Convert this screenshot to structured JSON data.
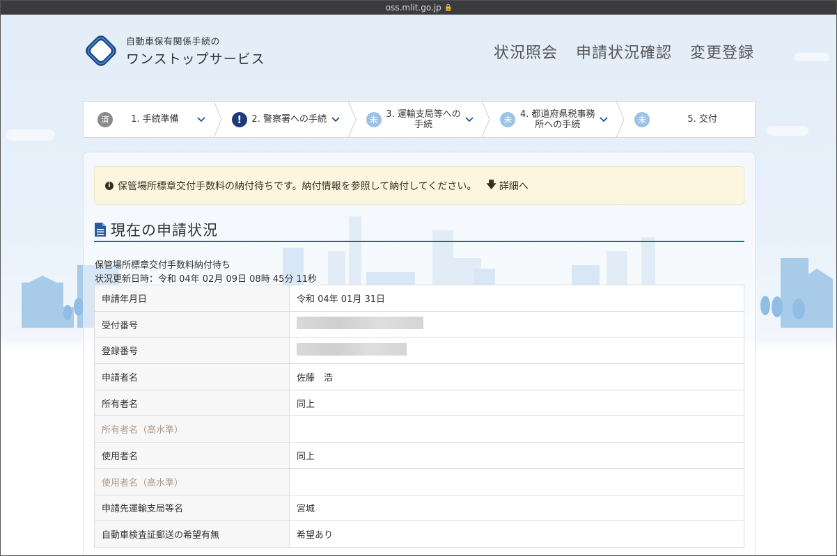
{
  "browser": {
    "url": "oss.mlit.go.jp"
  },
  "header": {
    "logo_small": "自動車保有関係手続の",
    "logo_big": "ワンストップサービス",
    "nav": [
      "状況照会",
      "申請状況確認",
      "変更登録"
    ]
  },
  "stepper": [
    {
      "badge": "済",
      "label": "1. 手続準備",
      "state": "done"
    },
    {
      "badge": "!",
      "label": "2. 警察署への手続",
      "state": "alert"
    },
    {
      "badge": "未",
      "label": "3. 運輸支局等への手続",
      "state": "todo"
    },
    {
      "badge": "未",
      "label": "4. 都道府県税事務所への手続",
      "state": "todo"
    },
    {
      "badge": "未",
      "label": "5. 交付",
      "state": "todo"
    }
  ],
  "alert": {
    "message": "保管場所標章交付手数料の納付待ちです。納付情報を参照して納付してください。",
    "link": "詳細へ"
  },
  "section": {
    "title": "現在の申請状況",
    "status": "保管場所標章交付手数料納付待ち",
    "updated": "状況更新日時：令和 04年 02月 09日 08時 45分 11秒"
  },
  "table": {
    "rows": [
      {
        "key": "申請年月日",
        "value": "令和 04年 01月 31日",
        "muted": false
      },
      {
        "key": "受付番号",
        "value": "",
        "redacted": true,
        "muted": false
      },
      {
        "key": "登録番号",
        "value": "",
        "redacted": true,
        "muted": false
      },
      {
        "key": "申請者名",
        "value": "佐藤　浩",
        "muted": false
      },
      {
        "key": "所有者名",
        "value": "同上",
        "muted": false
      },
      {
        "key": "所有者名（高水準）",
        "value": "",
        "muted": true
      },
      {
        "key": "使用者名",
        "value": "同上",
        "muted": false
      },
      {
        "key": "使用者名（高水準）",
        "value": "",
        "muted": true
      },
      {
        "key": "申請先運輸支局等名",
        "value": "宮城",
        "muted": false
      },
      {
        "key": "自動車検査証郵送の希望有無",
        "value": "希望あり",
        "muted": false
      }
    ]
  },
  "colors": {
    "accent": "#2a5aa3",
    "alert_bg": "#fcf6e0",
    "step_alert": "#1d3a7a",
    "step_todo": "#9cc3e6",
    "step_done": "#8a8a8a"
  }
}
